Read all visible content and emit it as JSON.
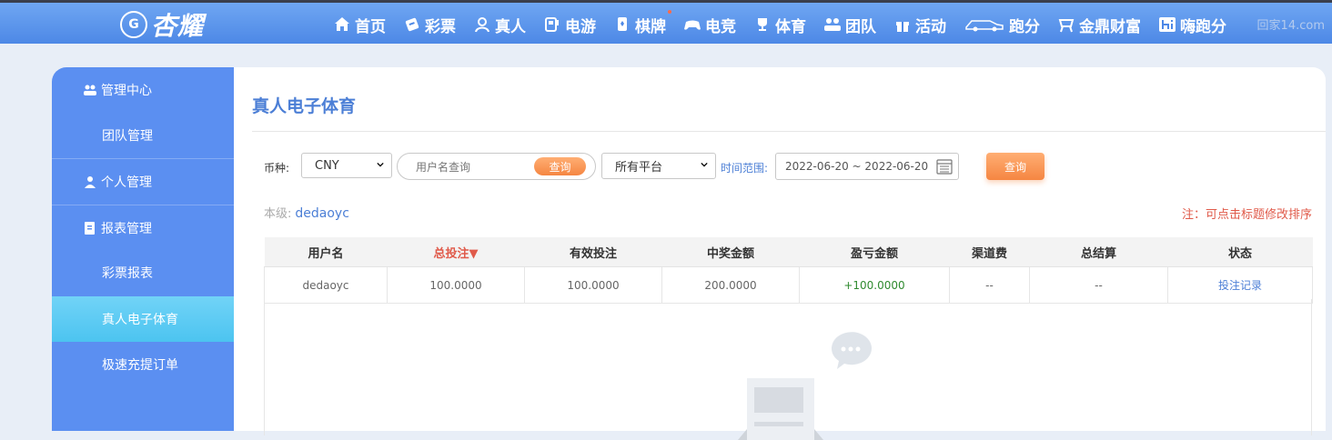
{
  "brand": {
    "logo_text": "杏耀",
    "badge_text": "G"
  },
  "nav": [
    {
      "label": "首页",
      "icon": "home-icon"
    },
    {
      "label": "彩票",
      "icon": "lottery-ticket-icon"
    },
    {
      "label": "真人",
      "icon": "dealer-icon"
    },
    {
      "label": "电游",
      "icon": "slot-machine-icon"
    },
    {
      "label": "棋牌",
      "icon": "cards-icon"
    },
    {
      "label": "电竞",
      "icon": "gamepad-icon"
    },
    {
      "label": "体育",
      "icon": "trophy-icon"
    },
    {
      "label": "团队",
      "icon": "team-icon"
    },
    {
      "label": "活动",
      "icon": "gift-icon"
    },
    {
      "label": "跑分",
      "icon": "running-car-icon"
    },
    {
      "label": "金鼎财富",
      "icon": "tripod-icon"
    },
    {
      "label": "嗨跑分",
      "icon": "hi-icon"
    }
  ],
  "watermark": "回家14.com",
  "sidebar": {
    "groups": [
      {
        "label": "管理中心",
        "icon": "team-icon"
      },
      {
        "label": "团队管理"
      },
      {
        "label": "个人管理",
        "icon": "user-icon"
      },
      {
        "label": "报表管理",
        "icon": "report-icon"
      },
      {
        "label": "彩票报表"
      },
      {
        "label": "真人电子体育"
      },
      {
        "label": "极速充提订单"
      }
    ]
  },
  "page": {
    "title": "真人电子体育",
    "currency_label": "币种:",
    "currency_value": "CNY",
    "username_placeholder": "用户名查询",
    "search_btn": "查询",
    "platform_value": "所有平台",
    "time_label": "时间范围:",
    "date_range": "2022-06-20 ~ 2022-06-20",
    "query_btn": "查询",
    "level_label": "本级:",
    "level_user": "dedaoyc",
    "note": "注：可点击标题修改排序"
  },
  "table": {
    "headers": [
      "用户名",
      "总投注▼",
      "有效投注",
      "中奖金额",
      "盈亏金额",
      "渠道费",
      "总结算",
      "状态"
    ],
    "rows": [
      [
        "dedaoyc",
        "100.0000",
        "100.0000",
        "200.0000",
        "+100.0000",
        "--",
        "--",
        "投注记录"
      ]
    ]
  },
  "colors": {
    "accent": "#4c7fd6",
    "sidebar": "#5b8ff1",
    "active": "#4cc4f0",
    "button": "#f58642",
    "warn": "#e05a4a",
    "positive": "#2f8a2f"
  }
}
